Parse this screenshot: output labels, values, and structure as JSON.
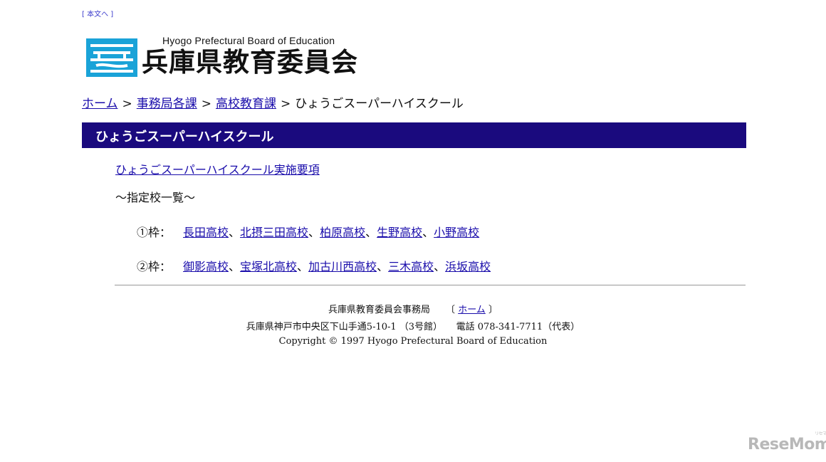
{
  "skip_link": "[ 本文へ ]",
  "logo": {
    "english": "Hyogo Prefectural Board of Education",
    "japanese": "兵庫県教育委員会",
    "colors": {
      "mark_blue": "#1aa3d8"
    }
  },
  "breadcrumb": {
    "items": [
      "ホーム",
      "事務局各課",
      "高校教育課"
    ],
    "separator": ">",
    "current": "ひょうごスーパーハイスクール"
  },
  "band": {
    "title": "ひょうごスーパーハイスクール",
    "color": "#1a0a7e"
  },
  "main_link": "ひょうごスーパーハイスクール実施要項",
  "list_heading": "～指定校一覧～",
  "rows": [
    {
      "label": "①枠：",
      "schools": [
        "長田高校",
        "北摂三田高校",
        "柏原高校",
        "生野高校",
        "小野高校"
      ]
    },
    {
      "label": "②枠：",
      "schools": [
        "御影高校",
        "宝塚北高校",
        "加古川西高校",
        "三木高校",
        "浜坂高校"
      ]
    }
  ],
  "footer": {
    "office": "兵庫県教育委員会事務局",
    "bracket_open": "〔",
    "home_link": "ホーム",
    "bracket_close": "〕",
    "address": "兵庫県神戸市中央区下山手通5-10-1 （3号館）　　電話 078-341-7711（代表）",
    "copyright": "Copyright © 1997 Hyogo Prefectural Board of Education"
  },
  "watermark": {
    "text": "ReseMom",
    "small": "リセマム"
  }
}
